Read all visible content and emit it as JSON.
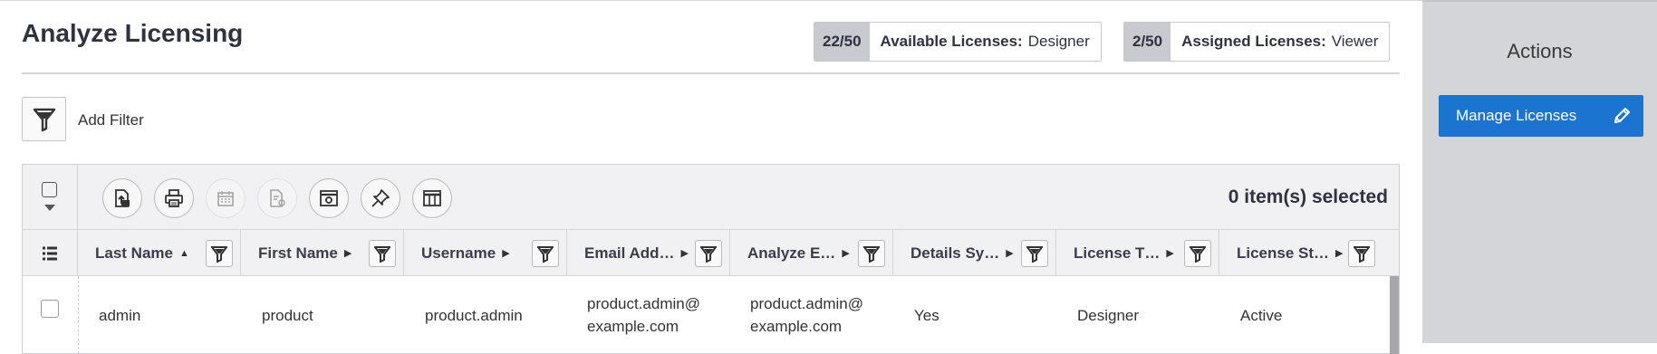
{
  "page": {
    "title": "Analyze Licensing"
  },
  "licenses": [
    {
      "count": "22/50",
      "label": "Available Licenses:",
      "type": "Designer"
    },
    {
      "count": "2/50",
      "label": "Assigned Licenses:",
      "type": "Viewer"
    }
  ],
  "filter": {
    "label": "Add Filter"
  },
  "toolbar": {
    "selected_text": "0 item(s) selected",
    "icons": [
      "export-icon",
      "print-icon",
      "calendar-icon",
      "schedule-report-icon",
      "settings-window-icon",
      "pin-icon",
      "columns-icon"
    ]
  },
  "columns": [
    {
      "label": "Last Name",
      "sort": "asc"
    },
    {
      "label": "First Name",
      "sort": "none"
    },
    {
      "label": "Username",
      "sort": "none"
    },
    {
      "label": "Email Add…",
      "sort": "none"
    },
    {
      "label": "Analyze E…",
      "sort": "none"
    },
    {
      "label": "Details Sy…",
      "sort": "none"
    },
    {
      "label": "License T…",
      "sort": "none"
    },
    {
      "label": "License St…",
      "sort": "none"
    }
  ],
  "rows": [
    {
      "last_name": "admin",
      "first_name": "product",
      "username": "product.admin",
      "email": "product.admin@ example.com",
      "analyze_email": "product.admin@ example.com",
      "details_sync": "Yes",
      "license_type": "Designer",
      "license_status": "Active"
    }
  ],
  "actions": {
    "title": "Actions",
    "manage_label": "Manage Licenses"
  },
  "colors": {
    "accent": "#1b75d0",
    "sidebar_bg": "#d4d5d8",
    "count_bg": "#c9cad0"
  }
}
